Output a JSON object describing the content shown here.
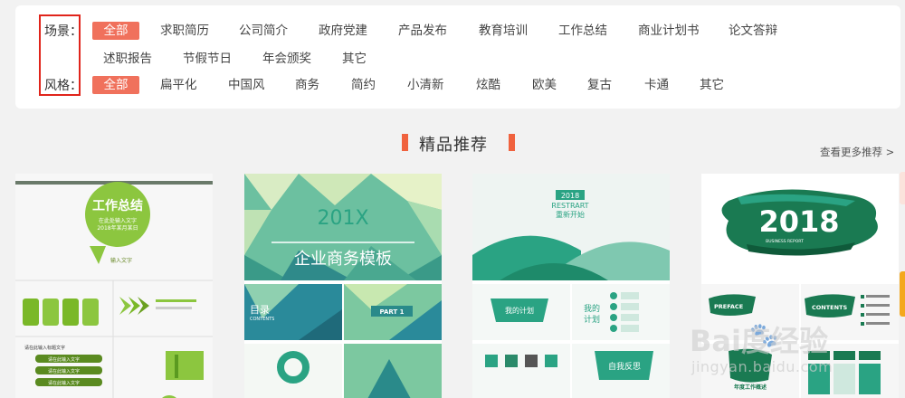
{
  "filters": {
    "scene": {
      "label": "场景：",
      "options": [
        "全部",
        "求职简历",
        "公司简介",
        "政府党建",
        "产品发布",
        "教育培训",
        "工作总结",
        "商业计划书",
        "论文答辩",
        "述职报告",
        "节假节日",
        "年会颁奖",
        "其它"
      ]
    },
    "style": {
      "label": "风格：",
      "options": [
        "全部",
        "扁平化",
        "中国风",
        "商务",
        "简约",
        "小清新",
        "炫酷",
        "欧美",
        "复古",
        "卡通",
        "其它"
      ]
    }
  },
  "section": {
    "title": "精品推荐",
    "more_link": "查看更多推荐 >"
  },
  "cards": [
    {
      "cover_title": "工作总结",
      "cover_sub1": "在此处输入文字",
      "cover_sub2": "2018年某月某日",
      "slide_caption": "输入文字",
      "list_heading": "请在此输入标题文字",
      "list_items": [
        "请在此输入文字",
        "请在此输入文字",
        "请在此输入文字"
      ]
    },
    {
      "year": "201X",
      "title": "企业商务模板",
      "toc_label": "目录",
      "toc_sub": "CONTENTS",
      "part_label": "PART 1"
    },
    {
      "year": "2018",
      "restart_en": "RESTRART",
      "restart_cn": "重新开始",
      "my_plan_a": "我的计划",
      "my_plan_b": "我的",
      "my_plan_c": "计划",
      "reflect": "自我反思"
    },
    {
      "year": "2018",
      "business_report": "BUSINESS REPORT",
      "preface": "PREFACE",
      "contents": "CONTENTS",
      "summary": "年度工作概述"
    }
  ],
  "watermark": {
    "brand": "Bai度经验",
    "url": "jingyan.baidu.com"
  },
  "colors": {
    "accent": "#f0715c",
    "title_bar": "#f0623e",
    "highlight_box": "#e0241b",
    "green": "#7ab828",
    "teal": "#2aa383",
    "dark_green": "#1a7a52"
  }
}
